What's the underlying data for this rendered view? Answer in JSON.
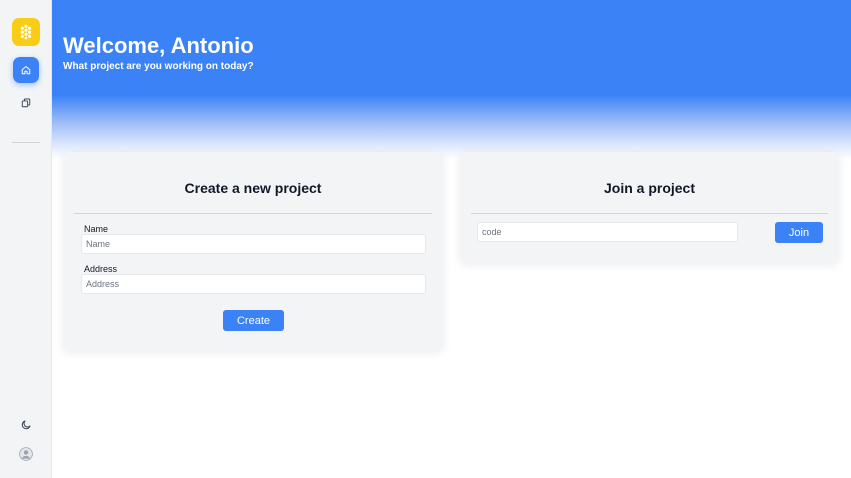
{
  "sidebar": {
    "items": [
      {
        "name": "home",
        "icon": "home-icon",
        "active": true
      },
      {
        "name": "projects",
        "icon": "copy-icon",
        "active": false
      }
    ],
    "bottom": [
      {
        "name": "theme",
        "icon": "moon-icon"
      },
      {
        "name": "profile",
        "icon": "user-icon"
      }
    ],
    "logo_icon": "hexagon-logo-icon"
  },
  "hero": {
    "title": "Welcome, Antonio",
    "subtitle": "What project are you working on today?"
  },
  "create_project": {
    "title": "Create a new project",
    "name_label": "Name",
    "name_placeholder": "Name",
    "address_label": "Address",
    "address_placeholder": "Address",
    "button_label": "Create"
  },
  "join_project": {
    "title": "Join a project",
    "code_placeholder": "code",
    "button_label": "Join"
  },
  "colors": {
    "accent": "#3b82f6",
    "logo": "#facc15",
    "card_bg": "#f3f4f6"
  }
}
